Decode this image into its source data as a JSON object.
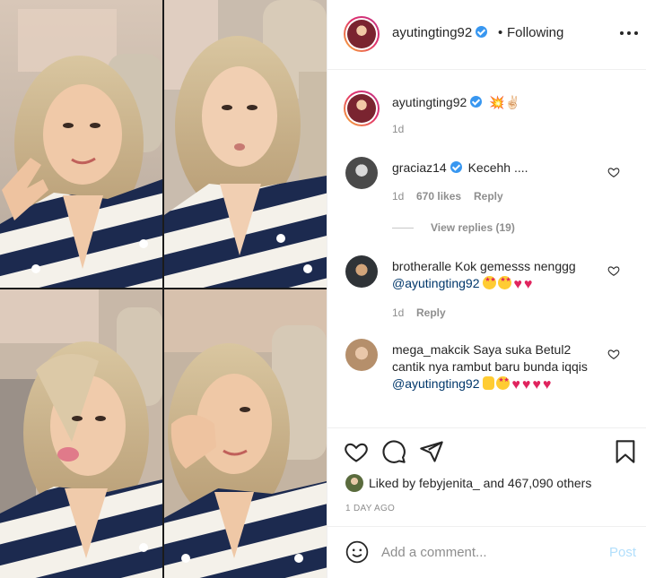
{
  "post": {
    "author": "ayutingting92",
    "follow_state": "Following",
    "dot_separator": "•",
    "caption_emoji": "💥✌🏻",
    "caption_time": "1d"
  },
  "comments": [
    {
      "user": "graciaz14",
      "verified": true,
      "text": "Kecehh ....",
      "time": "1d",
      "likes": "670 likes",
      "reply": "Reply",
      "view_replies": "View replies (19)"
    },
    {
      "user": "brotheralle",
      "verified": false,
      "text": "Kok gemesss nenggg",
      "mention": "@ayutingting92",
      "time": "1d",
      "reply": "Reply"
    },
    {
      "user": "mega_makcik",
      "verified": false,
      "text": "Saya suka Betul2 cantik nya rambut baru bunda iqqis",
      "mention": "@ayutingting92"
    }
  ],
  "likes": {
    "prefix": "Liked by",
    "user": "febyjenita_",
    "connector": "and",
    "others": "467,090 others"
  },
  "timestamp": "1 DAY AGO",
  "comment_box": {
    "placeholder": "Add a comment...",
    "post_label": "Post"
  },
  "colors": {
    "accent": "#3897f0",
    "post_disabled": "#b2dffc",
    "heart_emoji": "#e0245e",
    "sweater_navy": "#1c2a4f",
    "hair_blonde": "#c9b28a"
  },
  "icons": [
    "more-icon",
    "verified-badge-icon",
    "heart-icon",
    "comment-icon",
    "share-icon",
    "bookmark-icon",
    "smile-icon"
  ]
}
